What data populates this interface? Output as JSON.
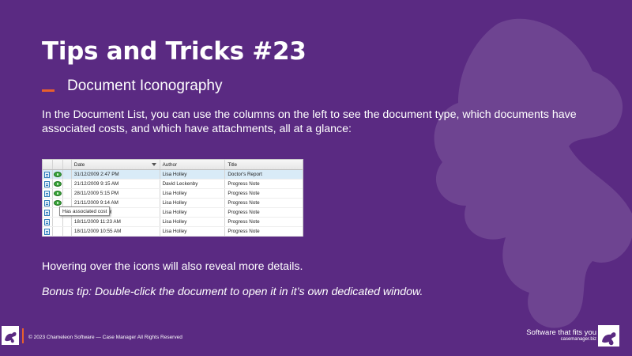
{
  "slide": {
    "title": "Tips and Tricks #23",
    "subtitle": "Document Iconography",
    "paragraph": "In the Document List, you can use the columns on the left to see the document type, which documents have associated costs, and which have attachments, all at a glance:",
    "hover_text": "Hovering over the icons will also reveal more details.",
    "bonus_text": "Bonus tip: Double-click the document to open it in it’s own dedicated window."
  },
  "document_list": {
    "columns": [
      "Date",
      "Author",
      "Title"
    ],
    "rows": [
      {
        "date": "31/12/2009 2:47 PM",
        "author": "Lisa Holley",
        "title": "Doctor's Report",
        "cost": true,
        "selected": true
      },
      {
        "date": "21/12/2009 9:15 AM",
        "author": "David Leckenby",
        "title": "Progress Note",
        "cost": true,
        "selected": false
      },
      {
        "date": "28/11/2009 5:15 PM",
        "author": "Lisa Holley",
        "title": "Progress Note",
        "cost": true,
        "selected": false
      },
      {
        "date": "21/11/2009 9:14 AM",
        "author": "Lisa Holley",
        "title": "Progress Note",
        "cost": true,
        "selected": false
      },
      {
        "date": "11/2009 5:20 PM",
        "author": "Lisa Holley",
        "title": "Progress Note",
        "cost": false,
        "selected": false
      },
      {
        "date": "18/11/2009 11:23 AM",
        "author": "Lisa Holley",
        "title": "Progress Note",
        "cost": false,
        "selected": false
      },
      {
        "date": "18/11/2009 10:55 AM",
        "author": "Lisa Holley",
        "title": "Progress Note",
        "cost": false,
        "selected": false
      }
    ],
    "tooltip": "Has associated cost"
  },
  "footer": {
    "copyright": "© 2023 Chameleon Software — Case Manager All Rights Reserved",
    "tagline": "Software that fits you",
    "url": "casemanager.biz"
  },
  "colors": {
    "background": "#5a2a82",
    "accent": "#e8602c",
    "selected_row": "#d9ebf7"
  },
  "icons": [
    "document-icon",
    "money-icon",
    "chameleon-logo-icon"
  ]
}
